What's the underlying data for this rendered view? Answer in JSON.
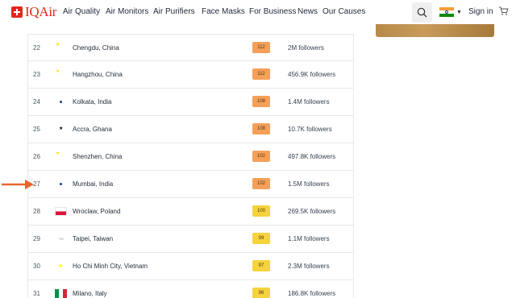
{
  "header": {
    "logo_text": "IQAir",
    "nav": [
      "Air Quality",
      "Air Monitors",
      "Air Purifiers",
      "Face Masks",
      "For Business",
      "News",
      "Our Causes"
    ],
    "signin": "Sign in"
  },
  "rows": [
    {
      "rank": "22",
      "flag": "cn",
      "city": "Chengdu, China",
      "aqi": "112",
      "color": "#f4a05a",
      "followers": "2M followers"
    },
    {
      "rank": "23",
      "flag": "cn",
      "city": "Hangzhou, China",
      "aqi": "112",
      "color": "#f4a05a",
      "followers": "456.9K followers"
    },
    {
      "rank": "24",
      "flag": "in",
      "city": "Kolkata, India",
      "aqi": "108",
      "color": "#f4a05a",
      "followers": "1.4M followers"
    },
    {
      "rank": "25",
      "flag": "gh",
      "city": "Accra, Ghana",
      "aqi": "108",
      "color": "#f4a05a",
      "followers": "10.7K followers"
    },
    {
      "rank": "26",
      "flag": "cn",
      "city": "Shenzhen, China",
      "aqi": "102",
      "color": "#f4a05a",
      "followers": "497.8K followers"
    },
    {
      "rank": "27",
      "flag": "in",
      "city": "Mumbai, India",
      "aqi": "102",
      "color": "#f4a05a",
      "followers": "1.5M followers"
    },
    {
      "rank": "28",
      "flag": "pl",
      "city": "Wroclaw, Poland",
      "aqi": "100",
      "color": "#f6d23c",
      "followers": "269.5K followers"
    },
    {
      "rank": "29",
      "flag": "tw",
      "city": "Taipei, Taiwan",
      "aqi": "99",
      "color": "#f6d23c",
      "followers": "1.1M followers"
    },
    {
      "rank": "30",
      "flag": "vn",
      "city": "Ho Chi Minh City, Vietnam",
      "aqi": "97",
      "color": "#f6d23c",
      "followers": "2.3M followers"
    },
    {
      "rank": "31",
      "flag": "it",
      "city": "Milano, Italy",
      "aqi": "96",
      "color": "#f6d23c",
      "followers": "186.8K followers"
    }
  ],
  "colors": {
    "brand": "#e2281b",
    "arrow": "#e8662d",
    "aqi_orange": "#f4a05a",
    "aqi_yellow": "#f6d23c"
  },
  "icons": {
    "search": "search-icon",
    "cart": "cart-icon",
    "caret": "chevron-down-icon"
  }
}
